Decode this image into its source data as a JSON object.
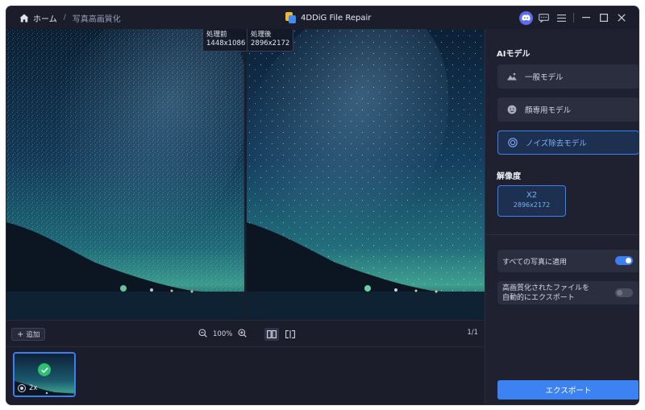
{
  "breadcrumb": {
    "home": "ホーム",
    "separator": "/",
    "current": "写真高画質化"
  },
  "app": {
    "title": "4DDiG File Repair"
  },
  "preview": {
    "before_tag": {
      "label": "処理前",
      "size": "1448x1086"
    },
    "after_tag": {
      "label": "処理後",
      "size": "2896x2172"
    }
  },
  "toolbar": {
    "add_label": "追加",
    "zoom_level": "100%",
    "page": "1/1"
  },
  "thumbnail": {
    "scale": "2x"
  },
  "sidebar": {
    "ai_model_title": "AIモデル",
    "models": [
      {
        "label": "一般モデル",
        "icon": "landscape-icon"
      },
      {
        "label": "顔専用モデル",
        "icon": "face-icon"
      },
      {
        "label": "ノイズ除去モデル",
        "icon": "target-icon",
        "selected": true
      }
    ],
    "resolution_title": "解像度",
    "resolution": {
      "scale": "X2",
      "size": "2896x2172"
    },
    "options": [
      {
        "label": "すべての写真に適用",
        "enabled": true
      },
      {
        "label_line1": "高画質化されたファイルを",
        "label_line2": "自動的にエクスポート",
        "enabled": false
      }
    ],
    "export_label": "エクスポート"
  },
  "colors": {
    "accent": "#3b7ff0",
    "window_bg": "#1b1d2b",
    "sidebar_bg": "#1f2131",
    "check_green": "#2fbf71"
  }
}
